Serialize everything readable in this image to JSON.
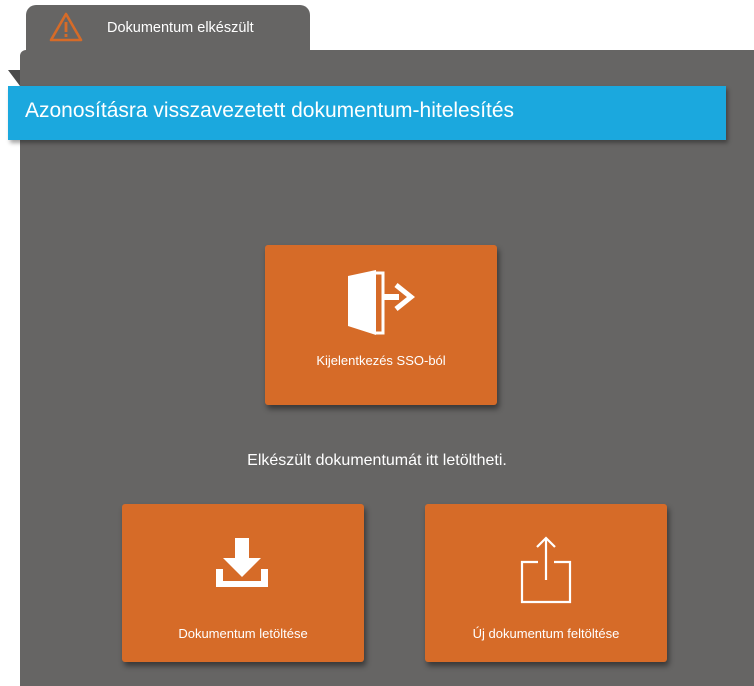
{
  "tab": {
    "label": "Dokumentum elkészült",
    "icon": "warning-triangle-icon"
  },
  "banner": {
    "title": "Azonosításra visszavezetett dokumentum-hitelesítés"
  },
  "logout": {
    "label": "Kijelentkezés SSO-ból",
    "icon": "exit-door-icon"
  },
  "info": {
    "text": "Elkészült dokumentumát itt letöltheti."
  },
  "download": {
    "label": "Dokumentum letöltése",
    "icon": "download-icon"
  },
  "upload": {
    "label": "Új dokumentum feltöltése",
    "icon": "upload-icon"
  },
  "colors": {
    "panel": "#666564",
    "banner": "#1ba8de",
    "tile": "#d66b28",
    "warning_icon": "#d66b28",
    "text": "#ffffff"
  }
}
